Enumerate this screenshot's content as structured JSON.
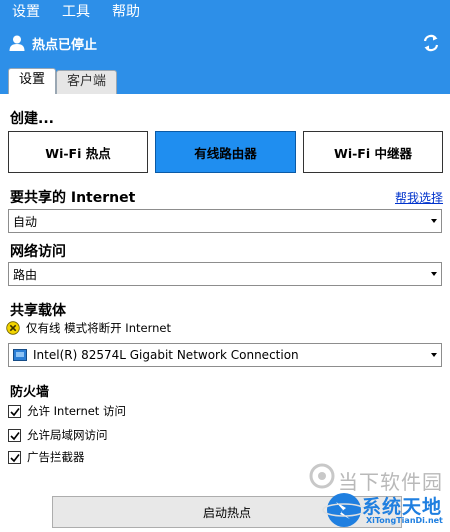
{
  "menu": {
    "items": [
      "设置",
      "工具",
      "帮助"
    ]
  },
  "status": {
    "text": "热点已停止"
  },
  "tabs": [
    {
      "label": "设置"
    },
    {
      "label": "客户端"
    }
  ],
  "create": {
    "label": "创建...",
    "modes": [
      "Wi-Fi 热点",
      "有线路由器",
      "Wi-Fi 中继器"
    ],
    "selected_index": 1
  },
  "internet": {
    "label": "要共享的 Internet",
    "help_link": "帮我选择",
    "value": "自动"
  },
  "network_access": {
    "label": "网络访问",
    "value": "路由"
  },
  "carrier": {
    "label": "共享载体",
    "warning": "仅有线 模式将断开 Internet",
    "adapter": "Intel(R) 82574L Gigabit Network Connection"
  },
  "firewall": {
    "label": "防火墙",
    "options": [
      {
        "label": "允许 Internet 访问",
        "checked": true
      },
      {
        "label": "允许局域网访问",
        "checked": true
      },
      {
        "label": "广告拦截器",
        "checked": true
      }
    ]
  },
  "start_button": {
    "label": "启动热点"
  },
  "watermark": {
    "line1": "当下软件园",
    "line2": "系统天地",
    "line3": "XiTongTianDi.net"
  },
  "colors": {
    "accent": "#2d8fe8",
    "selected_mode": "#1f8ef0",
    "link": "#0033cc"
  }
}
